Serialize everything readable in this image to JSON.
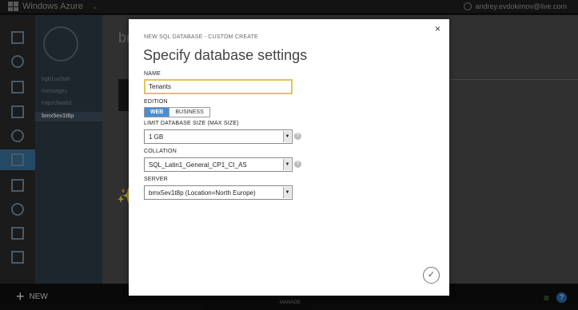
{
  "topbar": {
    "brand": "Windows Azure",
    "user": "andrey.evdokimov@live.com"
  },
  "subpanel": {
    "items": [
      "hg61ux0wh",
      "messages",
      "mtpzcfwa6d",
      "bmx5ev1t8p"
    ],
    "selected_index": 3
  },
  "main": {
    "title": "bm"
  },
  "bottombar": {
    "new_label": "NEW",
    "manage_label": "MANAGE",
    "help": "?"
  },
  "dialog": {
    "subtitle": "NEW SQL DATABASE - CUSTOM CREATE",
    "heading": "Specify database settings",
    "close": "×",
    "name_label": "NAME",
    "name_value": "Tenants",
    "edition_label": "EDITION",
    "edition_options": [
      "WEB",
      "BUSINESS"
    ],
    "edition_selected": "WEB",
    "size_label": "LIMIT DATABASE SIZE (MAX SIZE)",
    "size_value": "1 GB",
    "collation_label": "COLLATION",
    "collation_value": "SQL_Latin1_General_CP1_CI_AS",
    "server_label": "SERVER",
    "server_value": "bmx5ev1t8p (Location=North Europe)",
    "help_glyph": "?",
    "ok_glyph": "✓"
  },
  "icons": {
    "ok": "checkmark-icon",
    "close": "close-icon",
    "help": "help-icon"
  },
  "colors": {
    "accent": "#4a8ed1",
    "input_focus": "#e4c25b",
    "nav_selected": "#3a6f9a"
  }
}
